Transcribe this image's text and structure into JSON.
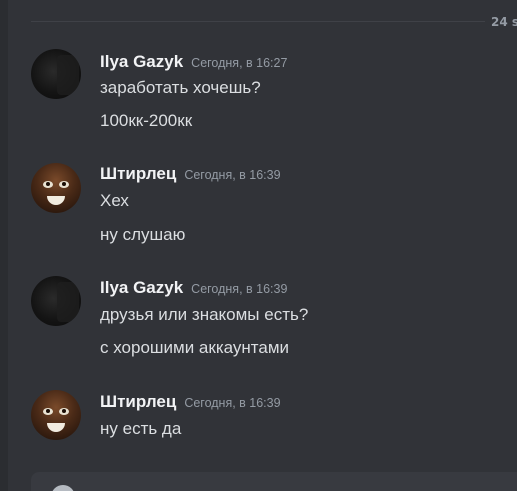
{
  "date_divider": {
    "label": "24 s"
  },
  "messages": [
    {
      "username": "Ilya Gazyk",
      "timestamp": "Сегодня, в 16:27",
      "lines": [
        "заработать хочешь?",
        "100кк-200кк"
      ]
    },
    {
      "username": "Штирлец",
      "timestamp": "Сегодня, в 16:39",
      "lines": [
        "Хех",
        "ну слушаю"
      ]
    },
    {
      "username": "Ilya Gazyk",
      "timestamp": "Сегодня, в 16:39",
      "lines": [
        "друзья или знакомы есть?",
        "с хорошими аккаунтами"
      ]
    },
    {
      "username": "Штирлец",
      "timestamp": "Сегодня, в 16:39",
      "lines": [
        "ну есть да"
      ]
    }
  ],
  "colors": {
    "background": "#313338",
    "username": "#f2f3f5",
    "timestamp": "#949ba4",
    "message_text": "#dbdee1"
  }
}
